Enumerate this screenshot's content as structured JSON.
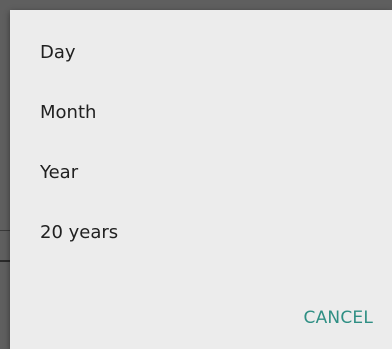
{
  "dialog": {
    "options": [
      {
        "label": "Day"
      },
      {
        "label": "Month"
      },
      {
        "label": "Year"
      },
      {
        "label": "20 years"
      }
    ],
    "cancel_label": "CANCEL"
  },
  "colors": {
    "dialog_background": "#ececec",
    "text": "#202020",
    "accent": "#2f8f84",
    "scrim": "#5f5f5f"
  }
}
